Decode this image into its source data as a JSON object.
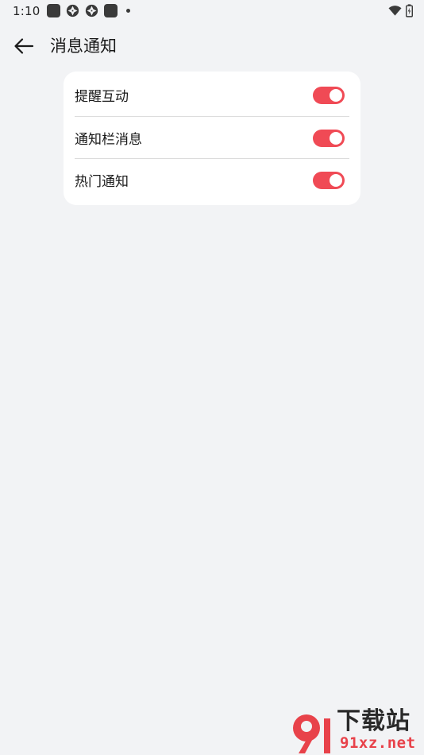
{
  "status_bar": {
    "time": "1:10",
    "left_icons": [
      "notification-square-icon",
      "aperture-icon",
      "aperture-icon",
      "notification-square-icon",
      "more-dot-icon"
    ],
    "right_icons": [
      "wifi-icon",
      "battery-charging-icon"
    ]
  },
  "header": {
    "title": "消息通知",
    "back_icon": "arrow-left-icon"
  },
  "settings": {
    "items": [
      {
        "label": "提醒互动",
        "enabled": true
      },
      {
        "label": "通知栏消息",
        "enabled": true
      },
      {
        "label": "热门通知",
        "enabled": true
      }
    ]
  },
  "watermark": {
    "logo_text": "9",
    "title": "下载站",
    "site": "91xz.net"
  },
  "colors": {
    "background": "#f2f3f5",
    "card": "#ffffff",
    "toggle_on": "#f04a55",
    "text": "#1a1a1a"
  }
}
